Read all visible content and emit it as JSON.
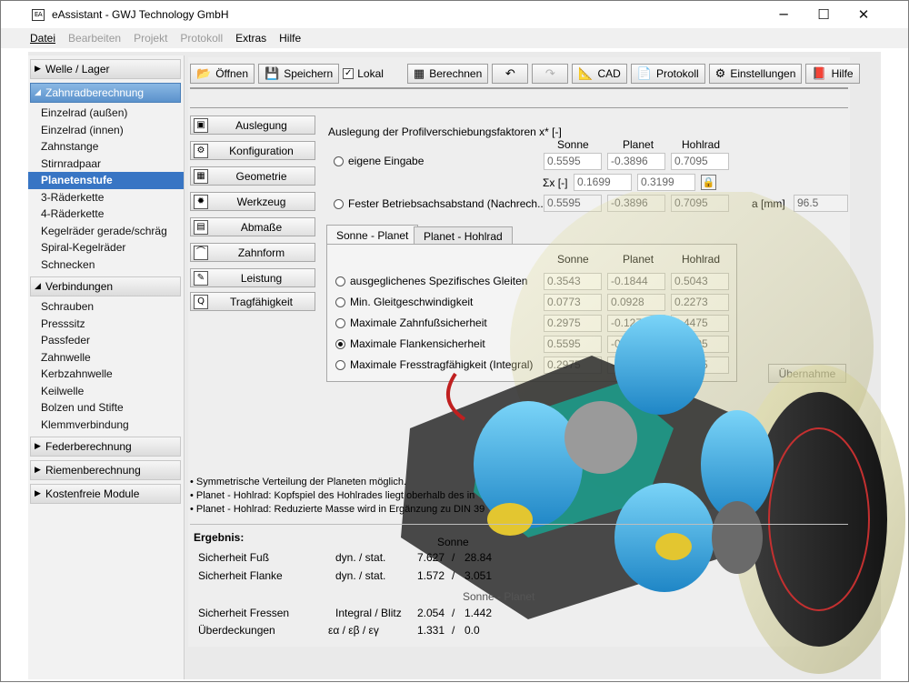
{
  "window": {
    "title": "eAssistant - GWJ Technology GmbH",
    "app_icon": "EA"
  },
  "menu": {
    "datei": "Datei",
    "bearbeiten": "Bearbeiten",
    "projekt": "Projekt",
    "protokoll": "Protokoll",
    "extras": "Extras",
    "hilfe": "Hilfe"
  },
  "sidebar": {
    "group_welle": "Welle / Lager",
    "group_zahnrad": "Zahnradberechnung",
    "zahnrad_items": [
      "Einzelrad (außen)",
      "Einzelrad (innen)",
      "Zahnstange",
      "Stirnradpaar",
      "Planetenstufe",
      "3-Räderkette",
      "4-Räderkette",
      "Kegelräder gerade/schräg",
      "Spiral-Kegelräder",
      "Schnecken"
    ],
    "group_verbindungen": "Verbindungen",
    "verbindungen_items": [
      "Schrauben",
      "Presssitz",
      "Passfeder",
      "Zahnwelle",
      "Kerbzahnwelle",
      "Keilwelle",
      "Bolzen und Stifte",
      "Klemmverbindung"
    ],
    "group_feder": "Federberechnung",
    "group_riemen": "Riemenberechnung",
    "group_kosten": "Kostenfreie Module"
  },
  "toolbar": {
    "open": "Öffnen",
    "save": "Speichern",
    "local": "Lokal",
    "calc": "Berechnen",
    "cad": "CAD",
    "protocol": "Protokoll",
    "settings": "Einstellungen",
    "help": "Hilfe"
  },
  "nav": [
    "Auslegung",
    "Konfiguration",
    "Geometrie",
    "Werkzeug",
    "Abmaße",
    "Zahnform",
    "Leistung",
    "Tragfähigkeit"
  ],
  "profile": {
    "heading": "Auslegung der Profilverschiebungsfaktoren x* [-]",
    "cols": [
      "Sonne",
      "Planet",
      "Hohlrad"
    ],
    "own_input": "eigene Eingabe",
    "own_values": [
      "0.5595",
      "-0.3896",
      "0.7095"
    ],
    "sum_label": "Σx [-]",
    "sum_values": [
      "0.1699",
      "0.3199"
    ],
    "fixed_label": "Fester Betriebsachsabstand (Nachrech...",
    "fixed_values": [
      "0.5595",
      "-0.3896",
      "0.7095"
    ],
    "a_label": "a [mm]",
    "a_value": "96.5"
  },
  "tabs": {
    "t1": "Sonne - Planet",
    "t2": "Planet - Hohlrad"
  },
  "options": {
    "cols": [
      "Sonne",
      "Planet",
      "Hohlrad"
    ],
    "rows": [
      {
        "label": "ausgeglichenes Spezifisches Gleiten",
        "values": [
          "0.3543",
          "-0.1844",
          "0.5043"
        ],
        "selected": false
      },
      {
        "label": "Min. Gleitgeschwindigkeit",
        "values": [
          "0.0773",
          "0.0928",
          "0.2273"
        ],
        "selected": false
      },
      {
        "label": "Maximale Zahnfußsicherheit",
        "values": [
          "0.2975",
          "-0.1275",
          "0.4475"
        ],
        "selected": false
      },
      {
        "label": "Maximale Flankensicherheit",
        "values": [
          "0.5595",
          "-0.3896",
          "0.7095"
        ],
        "selected": true
      },
      {
        "label": "Maximale Fresstragfähigkeit (Integral)",
        "values": [
          "0.2975",
          "-0.1275",
          "0.4475"
        ],
        "selected": false
      }
    ],
    "apply": "Übernahme"
  },
  "notes": [
    "• Symmetrische Verteilung der Planeten möglich.",
    "• Planet - Hohlrad: Kopfspiel des Hohlrades liegt oberhalb des in",
    "• Planet - Hohlrad: Reduzierte Masse wird in Ergänzung zu DIN 39"
  ],
  "results": {
    "heading": "Ergebnis:",
    "col_sonne": "Sonne",
    "col_sonne_planet": "Sonne - Planet",
    "rows": [
      {
        "label": "Sicherheit Fuß",
        "kind": "dyn. / stat.",
        "v1": "7.627",
        "sep": "/",
        "v2": "28.84"
      },
      {
        "label": "Sicherheit Flanke",
        "kind": "dyn. / stat.",
        "v1": "1.572",
        "sep": "/",
        "v2": "3.051"
      },
      {
        "label": "Sicherheit Fressen",
        "kind": "Integral / Blitz",
        "v1": "2.054",
        "sep": "/",
        "v2": "1.442"
      },
      {
        "label": "Überdeckungen",
        "kind": "εα / εβ / εγ",
        "v1": "1.331",
        "sep": "/",
        "v2": "0.0"
      }
    ]
  }
}
